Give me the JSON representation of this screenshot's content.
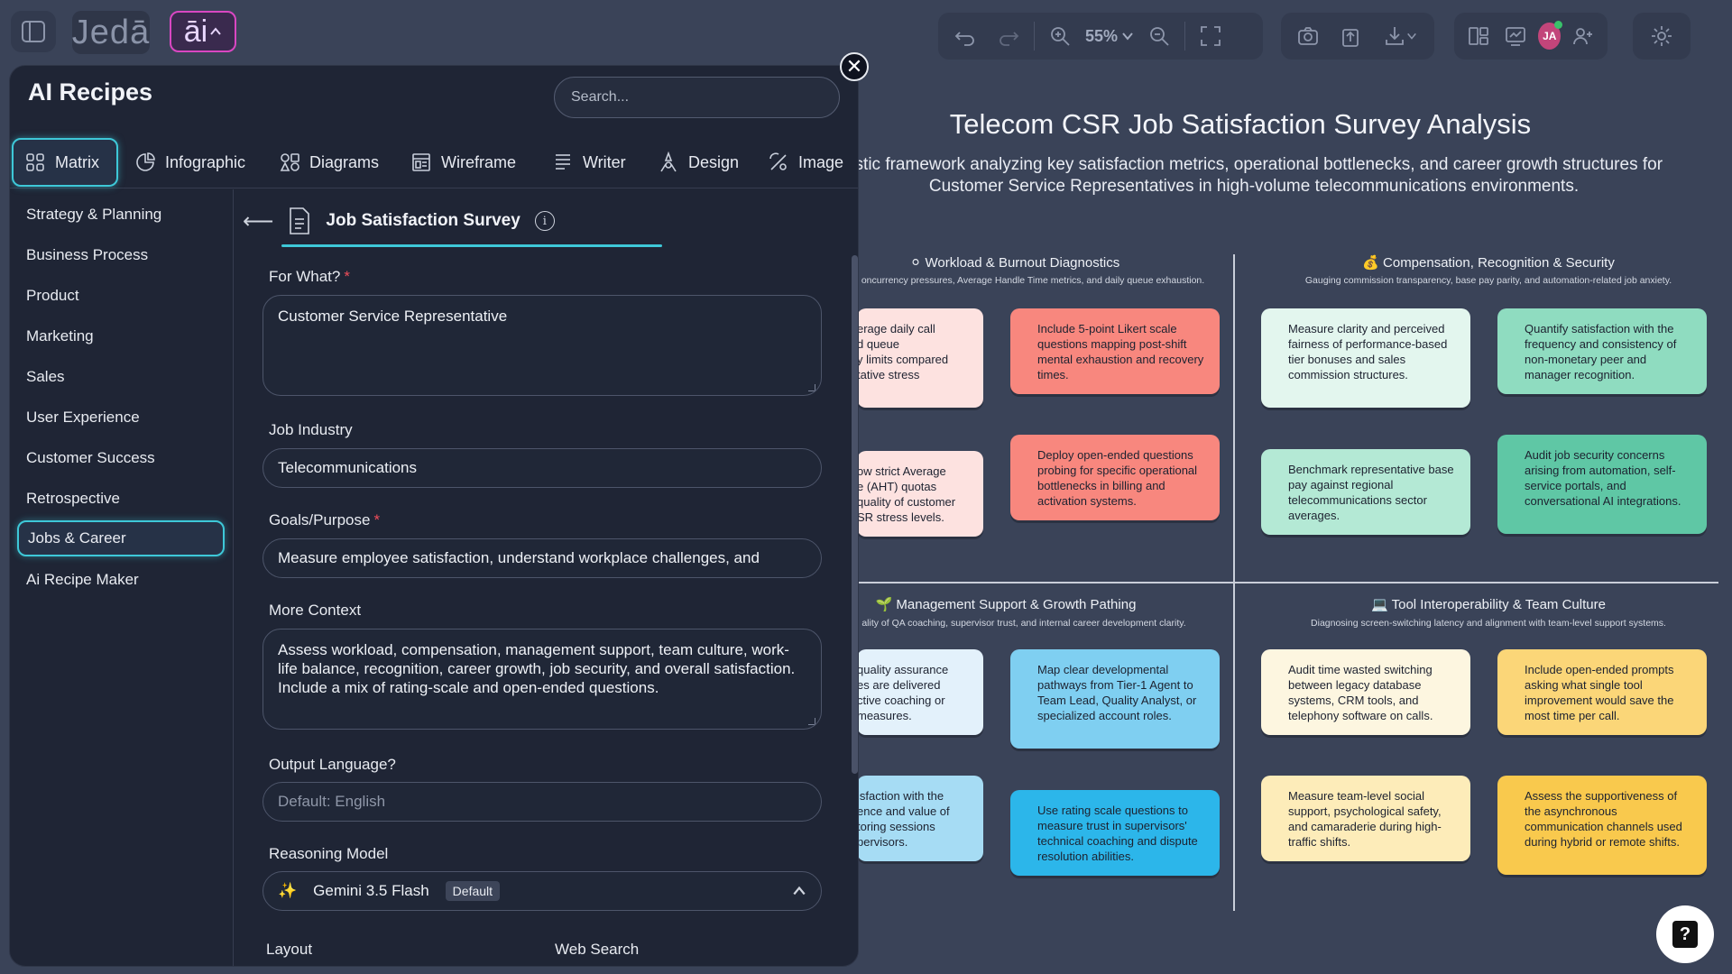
{
  "app": {
    "logo": "Jedā",
    "ai_label": "āi"
  },
  "toolbar": {
    "zoom": "55%",
    "avatar_initials": "JA"
  },
  "panel": {
    "title": "AI Recipes",
    "search_placeholder": "Search...",
    "tabs": [
      {
        "label": "Matrix",
        "icon": "grid-icon"
      },
      {
        "label": "Infographic",
        "icon": "pie-chart-icon"
      },
      {
        "label": "Diagrams",
        "icon": "shapes-icon"
      },
      {
        "label": "Wireframe",
        "icon": "wireframe-icon"
      },
      {
        "label": "Writer",
        "icon": "text-lines-icon"
      },
      {
        "label": "Design",
        "icon": "design-icon"
      },
      {
        "label": "Image",
        "icon": "image-icon"
      }
    ],
    "sidebar": [
      "Strategy & Planning",
      "Business Process",
      "Product",
      "Marketing",
      "Sales",
      "User Experience",
      "Customer Success",
      "Retrospective",
      "Jobs & Career",
      "Ai Recipe Maker"
    ],
    "form": {
      "title": "Job Satisfaction Survey",
      "for_what_label": "For What?",
      "for_what_value": "Customer Service Representative",
      "industry_label": "Job Industry",
      "industry_value": "Telecommunications",
      "goals_label": "Goals/Purpose",
      "goals_value": "Measure employee satisfaction, understand workplace challenges, and",
      "context_label": "More Context",
      "context_value": "Assess workload, compensation, management support, team culture, work-life balance, recognition, career growth, job security, and overall satisfaction. Include a mix of rating-scale and open-ended questions.",
      "language_label": "Output Language?",
      "language_placeholder": "Default: English",
      "model_label": "Reasoning Model",
      "model_value": "Gemini 3.5 Flash",
      "model_badge": "Default",
      "layout_label": "Layout",
      "web_search_label": "Web Search"
    }
  },
  "canvas": {
    "title": "Telecom CSR Job Satisfaction Survey Analysis",
    "subtitle": "ostic framework analyzing key satisfaction metrics, operational bottlenecks, and career growth structures for Customer Service Representatives in high-volume telecommunications environments.",
    "quadrants": [
      {
        "title": "⚪ Workload & Burnout Diagnostics",
        "subtitle": "oncurrency pressures, Average Handle Time metrics, and daily queue exhaustion.",
        "notes": [
          {
            "text": "erage daily call\nd queue\ny limits compared\ntative stress",
            "color": "#fde2e0"
          },
          {
            "text": "Include 5-point Likert scale questions mapping post-shift mental exhaustion and recovery times.",
            "color": "#f8877e"
          },
          {
            "text": "ow strict Average\ne (AHT) quotas\nquality of customer\nSR stress levels.",
            "color": "#fde2e0"
          },
          {
            "text": "Deploy open-ended questions probing for specific operational bottlenecks in billing and activation systems.",
            "color": "#f8877e"
          }
        ]
      },
      {
        "title": "💰 Compensation, Recognition & Security",
        "subtitle": "Gauging commission transparency, base pay parity, and automation-related job anxiety.",
        "notes": [
          {
            "text": "Measure clarity and perceived fairness of performance-based tier bonuses and sales commission structures.",
            "color": "#e3f6ee"
          },
          {
            "text": "Quantify satisfaction with the frequency and consistency of non-monetary peer and manager recognition.",
            "color": "#8fdcc0"
          },
          {
            "text": "Benchmark representative base pay against regional telecommunications sector averages.",
            "color": "#b4e9d5"
          },
          {
            "text": "Audit job security concerns arising from automation, self-service portals, and conversational AI integrations.",
            "color": "#5fc7a5"
          }
        ]
      },
      {
        "title": "🌱 Management Support & Growth Pathing",
        "subtitle": "ality of QA coaching, supervisor trust, and internal career development clarity.",
        "notes": [
          {
            "text": "quality assurance\nes are delivered\nctive coaching or\nmeasures.",
            "color": "#e3f1fb"
          },
          {
            "text": "Map clear developmental pathways from Tier-1 Agent to Team Lead, Quality Analyst, or specialized account roles.",
            "color": "#7fcff1"
          },
          {
            "text": "isfaction with the\nence and value of\ntoring sessions\npervisors.",
            "color": "#a6dcf4"
          },
          {
            "text": "Use rating scale questions to measure trust in supervisors' technical coaching and dispute resolution abilities.",
            "color": "#2cb6ea"
          }
        ]
      },
      {
        "title": "💻 Tool Interoperability & Team Culture",
        "subtitle": "Diagnosing screen-switching latency and alignment with team-level support systems.",
        "notes": [
          {
            "text": "Audit time wasted switching between legacy database systems, CRM tools, and telephony software on calls.",
            "color": "#fdf6e0"
          },
          {
            "text": "Include open-ended prompts asking what single tool improvement would save the most time per call.",
            "color": "#fbd678"
          },
          {
            "text": "Measure team-level social support, psychological safety, and camaraderie during high-traffic shifts.",
            "color": "#fdecb9"
          },
          {
            "text": "Assess the supportiveness of the asynchronous communication channels used during hybrid or remote shifts.",
            "color": "#f9c94d"
          }
        ]
      }
    ]
  }
}
